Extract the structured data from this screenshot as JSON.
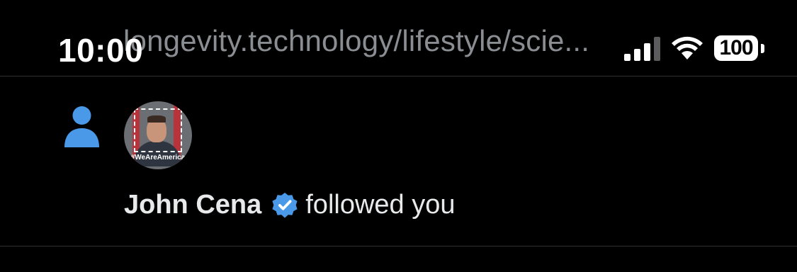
{
  "status_bar": {
    "time": "10:00",
    "url": "longevity.technology/lifestyle/scie...",
    "battery_level": "100",
    "signal_bars": 3,
    "icons": [
      "cellular-signal-icon",
      "wifi-icon",
      "battery-icon"
    ]
  },
  "notification": {
    "type_icon": "person-icon",
    "avatar_caption": "#WeAreAmerica",
    "user_name": "John Cena",
    "verified_icon": "verified-badge-icon",
    "action_text": "followed you"
  },
  "colors": {
    "background": "#000000",
    "icon_blue": "#4a99e9",
    "divider": "#2f3336",
    "url_gray": "#8a8d91"
  }
}
